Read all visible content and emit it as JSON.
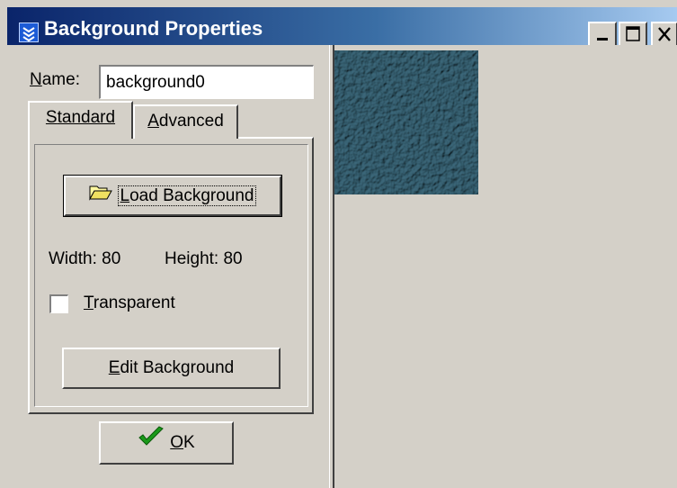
{
  "window": {
    "title": "Background Properties",
    "controls": [
      "minimize-icon",
      "maximize-icon",
      "close-icon"
    ]
  },
  "form": {
    "name_label_first": "N",
    "name_label_rest": "ame:",
    "name_value": "background0"
  },
  "tabs": [
    {
      "first": "S",
      "rest": "tandard",
      "active": true
    },
    {
      "first": "A",
      "rest": "dvanced",
      "active": false
    }
  ],
  "standard": {
    "load_button_icon": "folder-open-icon",
    "load_first": "L",
    "load_rest": "oad Background",
    "width_text": "Width: 80",
    "height_text": "Height: 80",
    "transparent_first": "T",
    "transparent_rest": "ransparent",
    "transparent_checked": false,
    "edit_first": "E",
    "edit_rest": "dit Background"
  },
  "ok": {
    "icon": "checkmark-icon",
    "first": "O",
    "rest": "K"
  },
  "colors": {
    "titlebar_start": "#0a246a",
    "titlebar_end": "#a6caf0",
    "texture": "#4e7684",
    "face": "#d4d0c8"
  }
}
